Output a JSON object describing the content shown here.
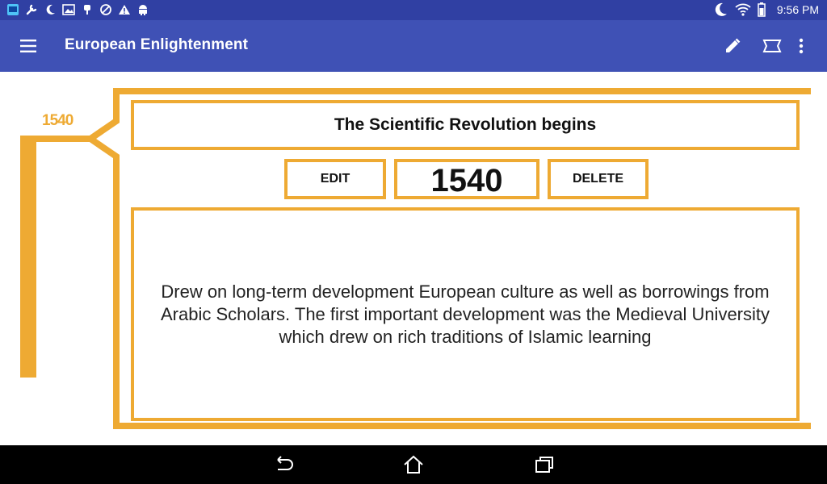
{
  "status_bar": {
    "time": "9:56 PM",
    "left_icons": [
      "image-icon",
      "wrench-icon",
      "moon-icon",
      "photo-icon",
      "usb-icon",
      "no-entry-icon",
      "warning-icon",
      "android-icon"
    ],
    "right_icons": [
      "moon-icon",
      "wifi-icon",
      "battery-icon"
    ]
  },
  "app_bar": {
    "title": "European Enlightenment",
    "actions": [
      "edit-icon",
      "view-icon",
      "overflow-menu-icon"
    ]
  },
  "timeline": {
    "marker_year": "1540"
  },
  "event": {
    "title": "The Scientific Revolution begins",
    "year": "1540",
    "edit_label": "EDIT",
    "delete_label": "DELETE",
    "description": "Drew on long-term development European culture as well as borrowings from Arabic Scholars. The first important development was the Medieval University which drew on rich traditions of Islamic learning"
  },
  "nav_bar": {
    "buttons": [
      "back-icon",
      "home-icon",
      "recents-icon"
    ]
  },
  "colors": {
    "status_bar": "#3040a3",
    "app_bar": "#3f51b5",
    "accent": "#eeaa33",
    "nav_bar": "#000000"
  }
}
